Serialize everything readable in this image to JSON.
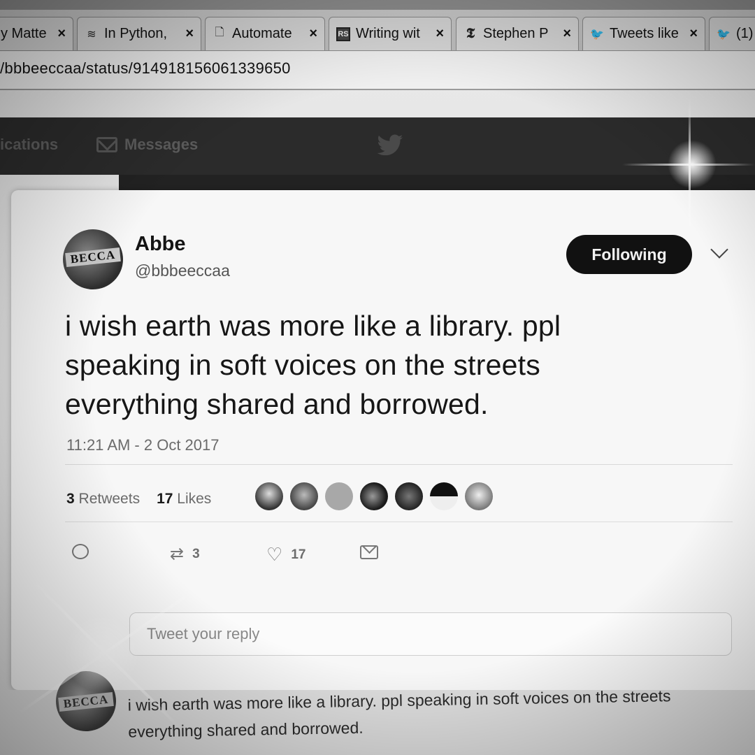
{
  "browser": {
    "tabs": [
      {
        "title": "y Matte",
        "icon": "page-icon"
      },
      {
        "title": "In Python,",
        "icon": "stack-icon"
      },
      {
        "title": "Automate",
        "icon": "document-icon"
      },
      {
        "title": "Writing wit",
        "icon": "rs-logo-icon"
      },
      {
        "title": "Stephen P",
        "icon": "nyt-logo-icon"
      },
      {
        "title": "Tweets like",
        "icon": "twitter-bird-icon"
      },
      {
        "title": "(1)",
        "icon": "twitter-bird-icon"
      }
    ],
    "close_glyph": "×",
    "url": "/bbbeeccaa/status/914918156061339650"
  },
  "twitter_nav": {
    "notifications_label": "ications",
    "messages_label": "Messages"
  },
  "tweet": {
    "author_name": "Abbe",
    "author_handle": "@bbbeeccaa",
    "avatar_text": "BECCA",
    "follow_label": "Following",
    "text": "i wish earth was more like a library. ppl speaking in soft voices on the streets everything shared and borrowed.",
    "timestamp": "11:21 AM - 2 Oct 2017",
    "retweets_count": "3",
    "retweets_label": "Retweets",
    "likes_count": "17",
    "likes_label": "Likes",
    "liker_count": 7,
    "actions": {
      "retweet_count": "3",
      "like_count": "17"
    },
    "reply_placeholder": "Tweet your reply"
  },
  "below_tweet": {
    "avatar_text": "BECCA",
    "text": "i wish earth was more like a library. ppl speaking in soft voices on the streets everything shared and borrowed."
  },
  "colors": {
    "follow_button_bg": "#111111",
    "nav_bg": "#2b2b2b"
  }
}
